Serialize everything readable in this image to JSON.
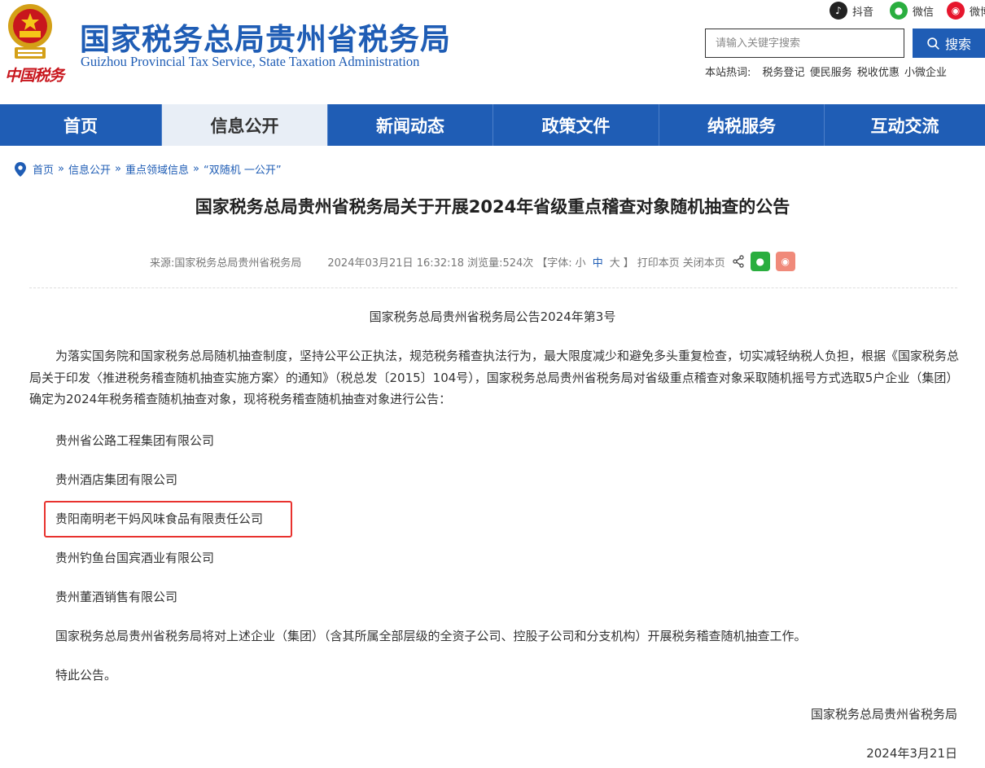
{
  "header": {
    "brand_mark": "中国税务",
    "title": "国家税务总局贵州省税务局",
    "subtitle": "Guizhou Provincial Tax Service, State Taxation Administration",
    "social": {
      "douyin": "抖音",
      "wechat": "微信",
      "weibo": "微博"
    },
    "search": {
      "placeholder": "请输入关键字搜索",
      "button_label": "搜索"
    },
    "hot": {
      "label": "本站热词:",
      "terms": [
        "税务登记",
        "便民服务",
        "税收优惠",
        "小微企业"
      ]
    }
  },
  "nav": {
    "items": [
      {
        "label": "首页"
      },
      {
        "label": "信息公开"
      },
      {
        "label": "新闻动态"
      },
      {
        "label": "政策文件"
      },
      {
        "label": "纳税服务"
      },
      {
        "label": "互动交流"
      }
    ]
  },
  "breadcrumb": [
    "首页",
    "信息公开",
    "重点领域信息",
    "“双随机 一公开”"
  ],
  "article": {
    "title": "国家税务总局贵州省税务局关于开展2024年省级重点稽查对象随机抽查的公告",
    "meta": {
      "source": "来源:国家税务总局贵州省税务局",
      "datetime": "2024年03月21日 16:32:18",
      "views": "浏览量:524次",
      "font_prefix": "【字体:",
      "font_small": "小",
      "font_medium": "中",
      "font_large": "大",
      "font_suffix": "】",
      "print": "打印本页",
      "close": "关闭本页"
    },
    "doc_no": "国家税务总局贵州省税务局公告2024年第3号",
    "intro": "为落实国务院和国家税务总局随机抽查制度，坚持公平公正执法，规范税务稽查执法行为，最大限度减少和避免多头重复检查，切实减轻纳税人负担，根据《国家税务总局关于印发〈推进税务稽查随机抽查实施方案〉的通知》（税总发〔2015〕104号），国家税务总局贵州省税务局对省级重点稽查对象采取随机摇号方式选取5户企业（集团）确定为2024年税务稽查随机抽查对象，现将税务稽查随机抽查对象进行公告：",
    "companies": [
      "贵州省公路工程集团有限公司",
      "贵州酒店集团有限公司",
      "贵阳南明老干妈风味食品有限责任公司",
      "贵州钓鱼台国宾酒业有限公司",
      "贵州董酒销售有限公司"
    ],
    "closing": "国家税务总局贵州省税务局将对上述企业（集团）（含其所属全部层级的全资子公司、控股子公司和分支机构）开展税务稽查随机抽查工作。",
    "notice": "特此公告。",
    "signature": "国家税务总局贵州省税务局",
    "date": "2024年3月21日"
  },
  "colors": {
    "brand_blue": "#1f5db5",
    "highlight_red": "#e8322e"
  }
}
